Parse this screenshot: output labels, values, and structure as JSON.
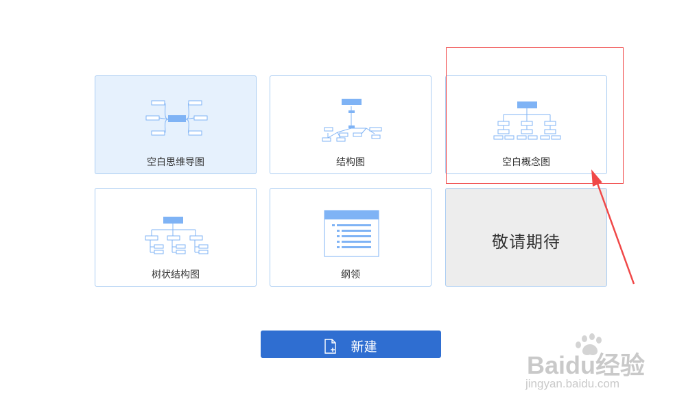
{
  "templates": [
    {
      "id": "mindmap",
      "label": "空白思维导图",
      "icon": "mindmap-thumbnail-icon",
      "selected": true
    },
    {
      "id": "structure",
      "label": "结构图",
      "icon": "structure-thumbnail-icon"
    },
    {
      "id": "concept",
      "label": "空白概念图",
      "icon": "concept-map-thumbnail-icon"
    },
    {
      "id": "tree",
      "label": "树状结构图",
      "icon": "tree-structure-thumbnail-icon"
    },
    {
      "id": "outline",
      "label": "纲领",
      "icon": "outline-thumbnail-icon"
    },
    {
      "id": "coming_soon",
      "label": "敬请期待"
    }
  ],
  "new_button": {
    "label": "新建",
    "icon": "new-file-icon"
  },
  "watermark": {
    "brand": "Baidu经验",
    "url": "jingyan.baidu.com"
  },
  "colors": {
    "accent": "#2f6ed1",
    "card_border": "#a9ccf2",
    "selected_bg": "#e6f1fd",
    "thumb_blue": "#7fb3f5",
    "annotation_red": "#f04848",
    "disabled_bg": "#ededed"
  }
}
